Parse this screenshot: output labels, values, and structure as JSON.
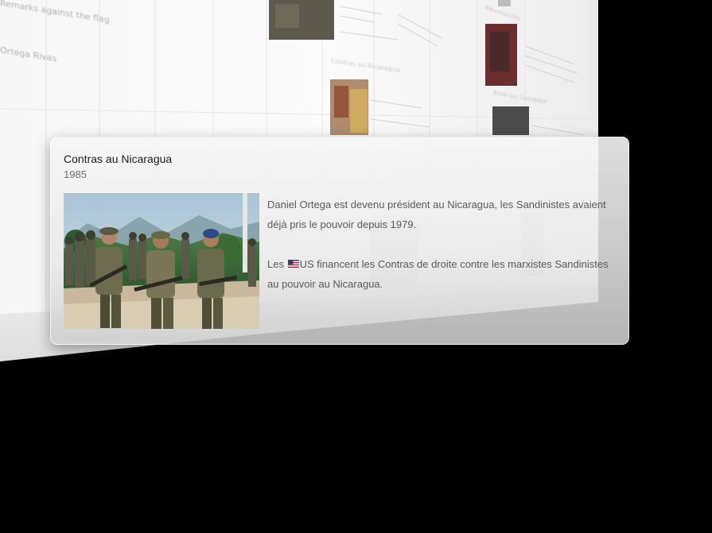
{
  "event": {
    "title": "Contras au Nicaragua",
    "year": "1985",
    "paragraph_1": "Daniel Ortega est devenu président au Nicaragua, les Sandinistes avaient déjà pris le pouvoir depuis 1979.",
    "paragraph_2_prefix": "Les",
    "flag_icon": "us-flag-icon",
    "paragraph_2_country": "US",
    "paragraph_2_rest": " financent les Contras de droite contre les marxistes Sandinistes au pouvoir au Nicaragua.",
    "photo_description_icon": "soldiers-photo"
  },
  "background": {
    "fragment_1": "Remarks against the flag",
    "fragment_2": "Ortega Rivas",
    "fragment_3": "Contras au Nicaragua",
    "fragment_4": "Revolución",
    "fragment_5": "Aide au Salvador"
  },
  "colors": {
    "card_title": "#1b1b1b",
    "card_year": "#6c6c6c",
    "card_body": "#5a5a5a",
    "wall": "#f4f4f4",
    "background": "#000000"
  }
}
